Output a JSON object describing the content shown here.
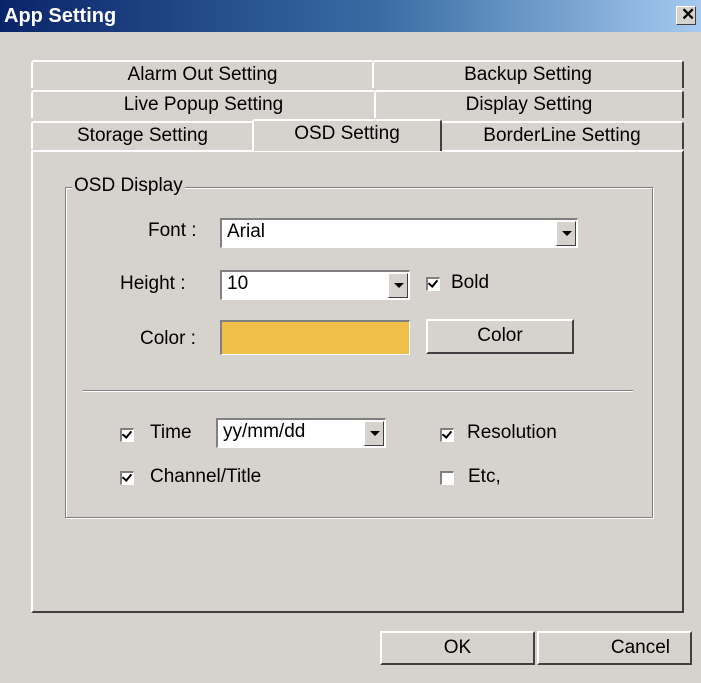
{
  "window": {
    "title": "App Setting",
    "close_glyph": "✕"
  },
  "tabs": {
    "row1": [
      "Alarm Out Setting",
      "Backup Setting"
    ],
    "row2": [
      "Live Popup Setting",
      "Display Setting"
    ],
    "row3": [
      "Storage Setting",
      "OSD Setting",
      "BorderLine Setting"
    ],
    "active": "OSD Setting"
  },
  "osd": {
    "group_label": "OSD Display",
    "font_label": "Font :",
    "font_value": "Arial",
    "height_label": "Height :",
    "height_value": "10",
    "bold_label": "Bold",
    "bold_checked": true,
    "color_label": "Color :",
    "color_swatch": "#f0bf4a",
    "color_button": "Color",
    "time_label": "Time",
    "time_checked": true,
    "time_format": "yy/mm/dd",
    "resolution_label": "Resolution",
    "resolution_checked": true,
    "channel_label": "Channel/Title",
    "channel_checked": true,
    "etc_label": "Etc,",
    "etc_checked": false
  },
  "footer": {
    "ok": "OK",
    "cancel": "Cancel"
  }
}
